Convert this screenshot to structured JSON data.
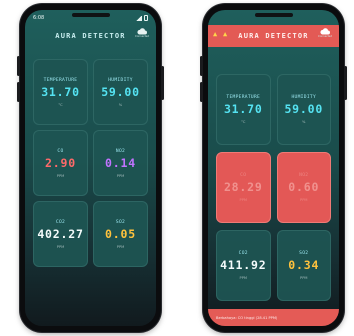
{
  "colors": {
    "screen_bg": "#1a4d4c",
    "card_bg": "#1e5452",
    "alert_red": "#e35856",
    "cyan": "#55e3f2",
    "red": "#ff6a6a",
    "purple": "#c173ff",
    "yellow": "#ffc23d",
    "white": "#f4fbfb"
  },
  "left_phone": {
    "status": {
      "time": "6:08"
    },
    "app_title": "AURA DETECTOR",
    "cloud": {
      "icon": "cloud-icon",
      "label": "Connected"
    },
    "cards": [
      {
        "label": "TEMPERATURE",
        "value": "31.70",
        "unit": "°C"
      },
      {
        "label": "HUMIDITY",
        "value": "59.00",
        "unit": "%"
      },
      {
        "label": "CO",
        "value": "2.90",
        "unit": "PPM"
      },
      {
        "label": "NO2",
        "value": "0.14",
        "unit": "PPM"
      },
      {
        "label": "CO2",
        "value": "402.27",
        "unit": "PPM"
      },
      {
        "label": "SO2",
        "value": "0.05",
        "unit": "PPM"
      }
    ]
  },
  "right_phone": {
    "app_title": "AURA DETECTOR",
    "warning_icons": [
      "warning-icon",
      "warning-icon"
    ],
    "cloud": {
      "icon": "cloud-icon",
      "label": "Connected"
    },
    "cards": [
      {
        "label": "TEMPERATURE",
        "value": "31.70",
        "unit": "°C"
      },
      {
        "label": "HUMIDITY",
        "value": "59.00",
        "unit": "%"
      },
      {
        "label": "CO",
        "value": "28.29",
        "unit": "PPM"
      },
      {
        "label": "NO2",
        "value": "0.60",
        "unit": "PPM"
      },
      {
        "label": "CO2",
        "value": "411.92",
        "unit": "PPM"
      },
      {
        "label": "SO2",
        "value": "0.34",
        "unit": "PPM"
      }
    ],
    "notification": "Berbahaya: CO tinggi (28.41 PPM)"
  }
}
